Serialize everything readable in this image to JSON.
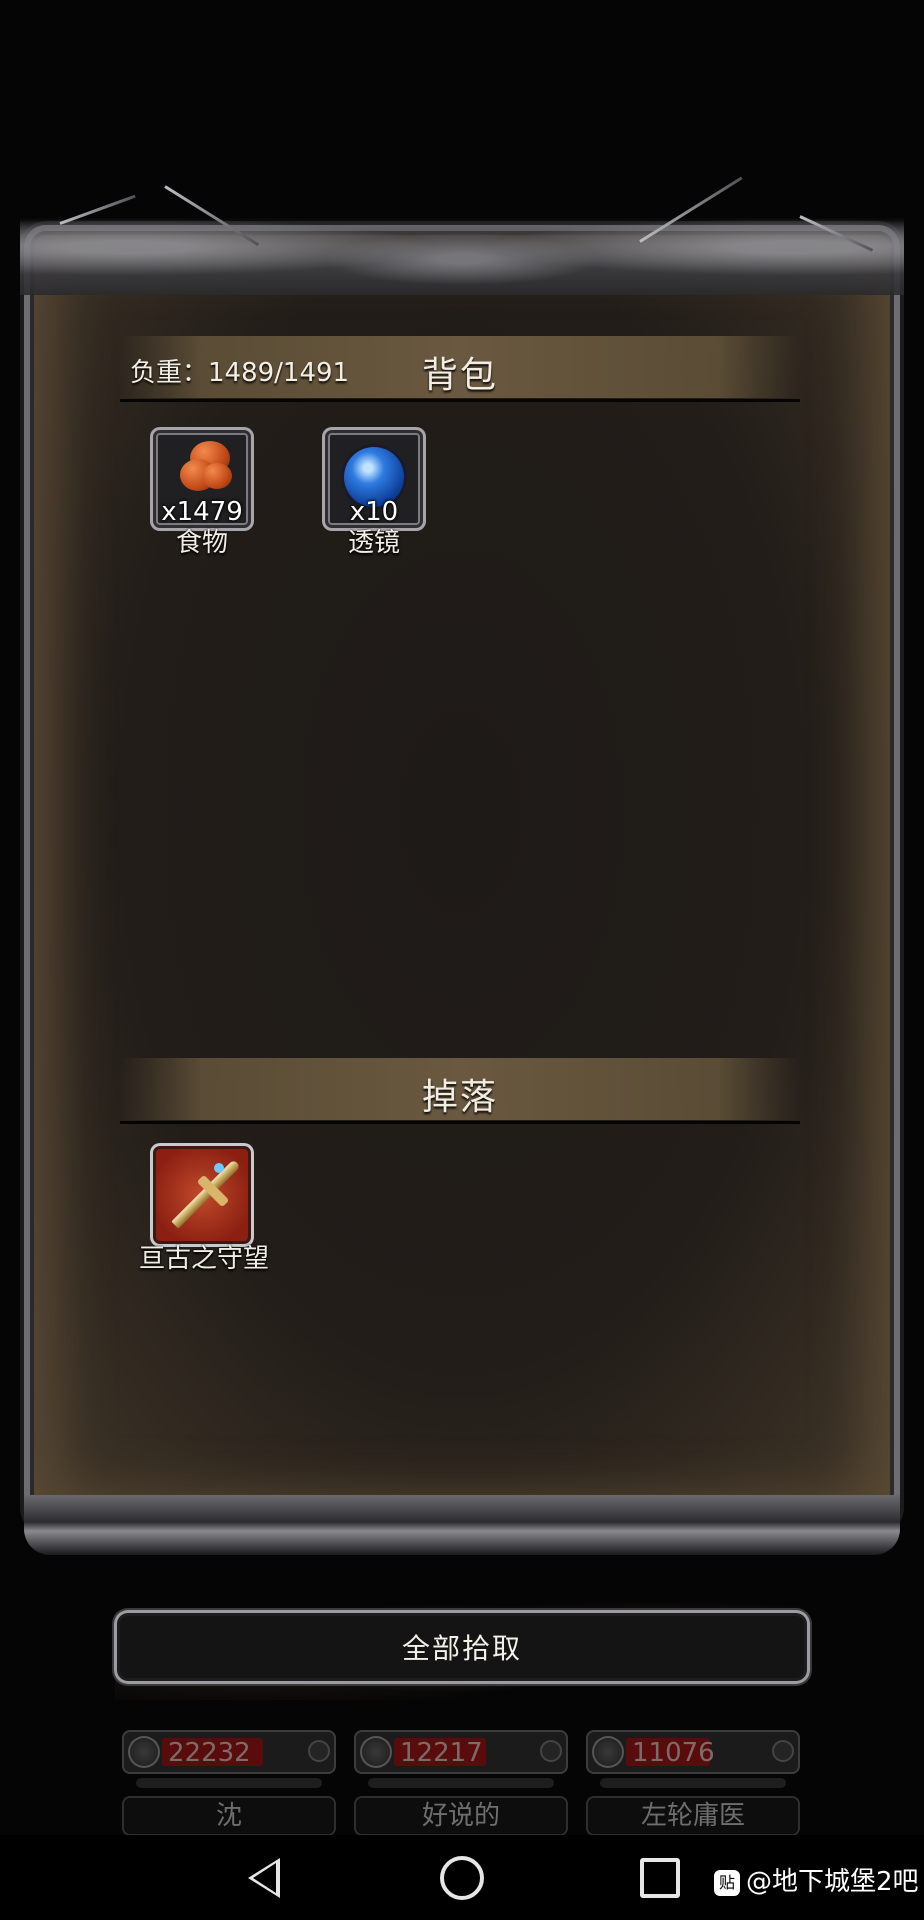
{
  "backpack": {
    "title": "背包",
    "weight_label": "负重：1489/1491",
    "items": [
      {
        "name": "食物",
        "qty": "x1479",
        "icon": "food-drumstick-icon"
      },
      {
        "name": "透镜",
        "qty": "x10",
        "icon": "blue-lens-orb-icon"
      }
    ]
  },
  "drops": {
    "title": "掉落",
    "items": [
      {
        "name": "亘古之守望",
        "icon": "golden-sword-icon"
      }
    ]
  },
  "actions": {
    "pick_all_label": "全部拾取"
  },
  "party": [
    {
      "hp": "22232",
      "name": "沈",
      "hp_fraction": 0.6
    },
    {
      "hp": "12217",
      "name": "好说的",
      "hp_fraction": 0.55
    },
    {
      "hp": "11076",
      "name": "左轮庸医",
      "hp_fraction": 0.5
    }
  ],
  "navbar": {
    "watermark": "@地下城堡2吧",
    "watermark_logo": "贴"
  },
  "colors": {
    "panel": "#221d19",
    "header_bar": "#6a5940",
    "hp_fill": "#5a0c0c",
    "drop_slot": "#8a1f12"
  }
}
